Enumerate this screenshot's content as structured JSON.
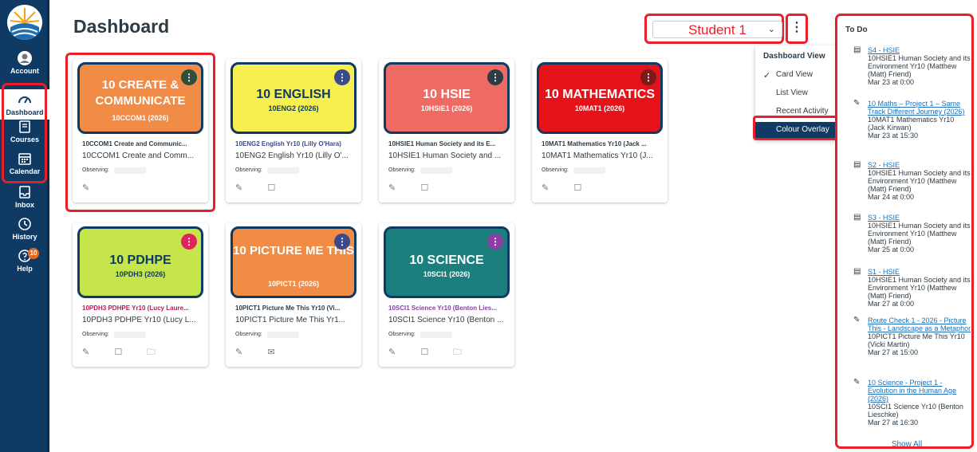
{
  "nav": {
    "account": "Account",
    "dashboard": "Dashboard",
    "courses": "Courses",
    "calendar": "Calendar",
    "inbox": "Inbox",
    "history": "History",
    "help": "Help",
    "help_badge": "10"
  },
  "header": {
    "title": "Dashboard",
    "observee_selected": "Student 1",
    "more_button": "⋮"
  },
  "dashboard_menu": {
    "title": "Dashboard View",
    "items": [
      "Card View",
      "List View",
      "Recent Activity",
      "Colour Overlay"
    ],
    "checked": "Card View",
    "highlighted": "Colour Overlay"
  },
  "cards": [
    {
      "name": "10 CREATE & COMMUNICATE",
      "code": "10CCOM1 (2026)",
      "link": "10CCOM1 Create and Communic...",
      "sub": "10CCOM1 Create and Comm...",
      "observing": "Observing:",
      "color": "#f08c45",
      "kebab_color": "#2f4f3a",
      "link_color": "#2d3b45"
    },
    {
      "name": "10 ENGLISH",
      "code": "10ENG2 (2026)",
      "link": "10ENG2 English Yr10 (Lilly O'Hara)",
      "sub": "10ENG2 English Yr10 (Lilly O'...",
      "observing": "Observing:",
      "color": "#f7ef4f",
      "kebab_color": "#3b4a8a",
      "link_color": "#3b4a8a"
    },
    {
      "name": "10 HSIE",
      "code": "10HSIE1 (2026)",
      "link": "10HSIE1 Human Society and its E...",
      "sub": "10HSIE1 Human Society and ...",
      "observing": "Observing:",
      "color": "#ef6a62",
      "kebab_color": "#2d3b45",
      "link_color": "#2d3b45"
    },
    {
      "name": "10 MATHEMATICS",
      "code": "10MAT1 (2026)",
      "link": "10MAT1 Mathematics Yr10 (Jack ...",
      "sub": "10MAT1 Mathematics Yr10 (J...",
      "observing": "Observing:",
      "color": "#e6121a",
      "kebab_color": "#7a1a1a",
      "link_color": "#2d3b45"
    },
    {
      "name": "10 PDHPE",
      "code": "10PDH3 (2026)",
      "link": "10PDH3 PDHPE Yr10 (Lucy Laure...",
      "sub": "10PDH3 PDHPE Yr10 (Lucy L...",
      "observing": "Observing:",
      "color": "#c6e54a",
      "kebab_color": "#e0235f",
      "link_color": "#c0145a"
    },
    {
      "name": "10 PICTURE ME THIS",
      "code": "10PICT1 (2026)",
      "link": "10PICT1 Picture Me This Yr10 (Vi...",
      "sub": "10PICT1 Picture Me This Yr1...",
      "observing": "Observing:",
      "color": "#f08c45",
      "kebab_color": "#3b4a8a",
      "link_color": "#2d3b45"
    },
    {
      "name": "10 SCIENCE",
      "code": "10SCI1 (2026)",
      "link": "10SCI1 Science Yr10 (Benton Lies...",
      "sub": "10SCI1 Science Yr10 (Benton ...",
      "observing": "Observing:",
      "color": "#1a7f7d",
      "kebab_color": "#8b3fa6",
      "link_color": "#8b3fa6"
    }
  ],
  "todo": {
    "title": "To Do",
    "items": [
      {
        "link": "S4 - HSIE",
        "desc": "10HSIE1 Human Society and its Environment Yr10 (Matthew (Matt) Friend)",
        "date": "Mar 23 at 0:00"
      },
      {
        "link": "10 Maths – Project 1 – Same Track Different Journey (2026)",
        "desc": "10MAT1 Mathematics Yr10 (Jack Kirwan)",
        "date": "Mar 23 at 15:30"
      },
      {
        "link": "S2 - HSIE",
        "desc": "10HSIE1 Human Society and its Environment Yr10 (Matthew (Matt) Friend)",
        "date": "Mar 24 at 0:00"
      },
      {
        "link": "S3 - HSIE",
        "desc": "10HSIE1 Human Society and its Environment Yr10 (Matthew (Matt) Friend)",
        "date": "Mar 25 at 0:00"
      },
      {
        "link": "S1 - HSIE",
        "desc": "10HSIE1 Human Society and its Environment Yr10 (Matthew (Matt) Friend)",
        "date": "Mar 27 at 0:00"
      },
      {
        "link": "Route Check 1 - 2026 - Picture This - Landscape as a Metaphor",
        "desc": "10PICT1 Picture Me This Yr10 (Vicki Martin)",
        "date": "Mar 27 at 15:00"
      },
      {
        "link": "10 Science - Project 1 - Evolution in the Human Age (2026)",
        "desc": "10SCI1 Science Yr10 (Benton Lieschke)",
        "date": "Mar 27 at 16:30"
      }
    ],
    "show_all": "Show All"
  },
  "colors": {
    "nav_bg": "#0e3a63",
    "highlight_red": "#e8202a",
    "link_blue": "#1d6fb8"
  }
}
